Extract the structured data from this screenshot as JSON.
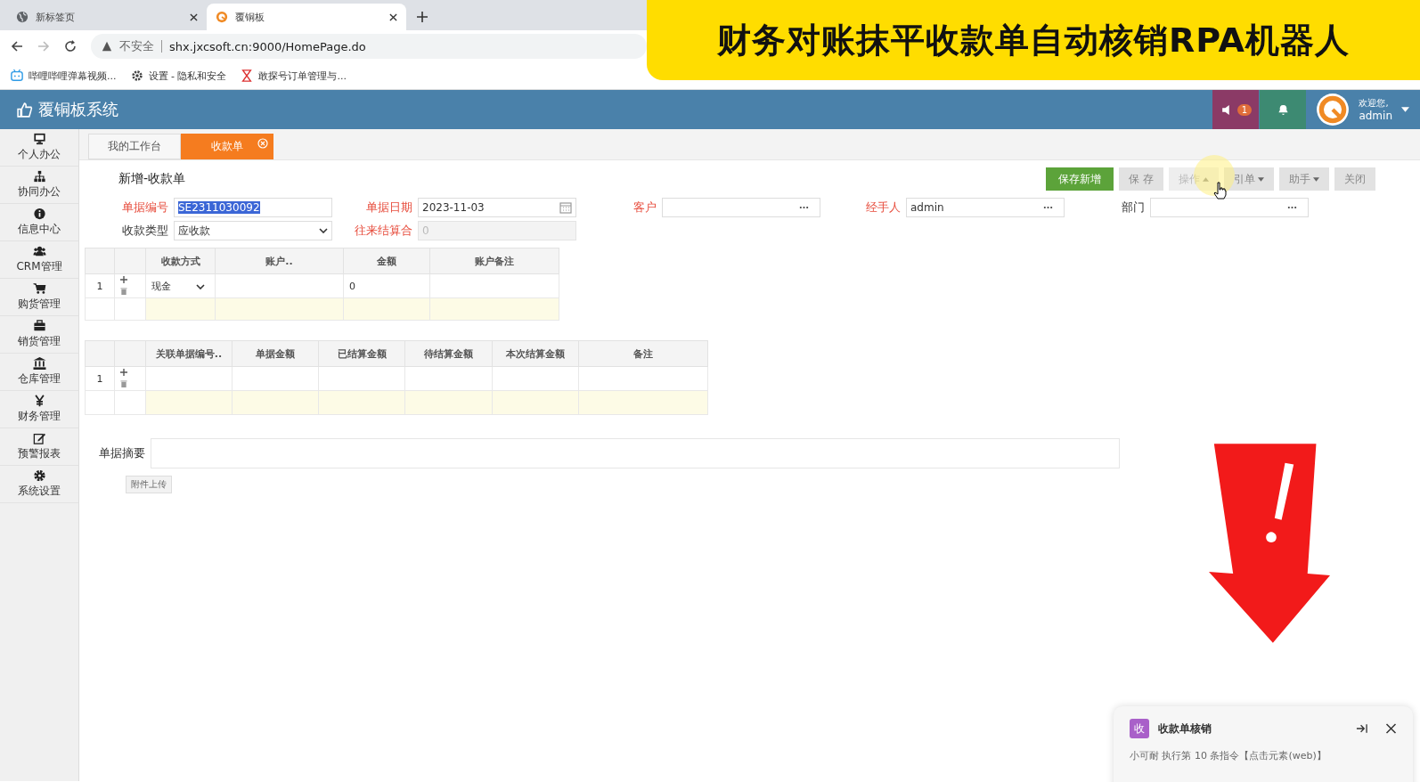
{
  "browser": {
    "tabs": [
      {
        "title": "新标签页",
        "selected": false
      },
      {
        "title": "覆铜板",
        "selected": true
      }
    ],
    "address": {
      "security": "不安全",
      "url": "shx.jxcsoft.cn:9000/HomePage.do"
    },
    "bookmarks": [
      "哔哩哔哩弹幕视频...",
      "设置 - 隐私和安全",
      "敢探号订单管理与..."
    ]
  },
  "app": {
    "title": "覆铜板系统",
    "badge": "1",
    "greeting": "欢迎您,",
    "user": "admin"
  },
  "sidebar": {
    "items": [
      {
        "label": "个人办公"
      },
      {
        "label": "协同办公"
      },
      {
        "label": "信息中心"
      },
      {
        "label": "CRM管理"
      },
      {
        "label": "购货管理"
      },
      {
        "label": "销货管理"
      },
      {
        "label": "仓库管理"
      },
      {
        "label": "财务管理"
      },
      {
        "label": "预警报表"
      },
      {
        "label": "系统设置"
      }
    ]
  },
  "page_tabs": [
    {
      "label": "我的工作台",
      "selected": false
    },
    {
      "label": "收款单",
      "selected": true,
      "closable": true
    }
  ],
  "form": {
    "title": "新增-收款单",
    "toolbar": [
      {
        "label": "保存新增",
        "kind": "primary",
        "dropdown": false
      },
      {
        "label": "保 存",
        "kind": "default",
        "dropdown": false
      },
      {
        "label": "操作",
        "kind": "hovered",
        "dropdown": true
      },
      {
        "label": "引单",
        "kind": "default",
        "dropdown": true
      },
      {
        "label": "助手",
        "kind": "default",
        "dropdown": true
      },
      {
        "label": "关闭",
        "kind": "default",
        "dropdown": false
      }
    ],
    "fields": [
      {
        "label": "单据编号",
        "required": true,
        "kind": "text",
        "value": "SE2311030092",
        "highlighted": true,
        "disabled": false
      },
      {
        "label": "单据日期",
        "required": true,
        "kind": "date",
        "value": "2023-11-03",
        "disabled": false
      },
      {
        "label": "客户",
        "required": true,
        "kind": "lookup",
        "disabled": false
      },
      {
        "label": "经手人",
        "required": true,
        "kind": "lookup",
        "value": "admin",
        "disabled": false
      },
      {
        "label": "部门",
        "required": false,
        "kind": "lookup",
        "disabled": false
      },
      {
        "label": "收款类型",
        "required": false,
        "kind": "select",
        "value": "应收款",
        "disabled": false
      },
      {
        "label": "往来结算合",
        "required": true,
        "kind": "text",
        "value": "0",
        "disabled": true
      }
    ],
    "payment_table": {
      "columns": [
        "收款方式",
        "账户..",
        "金额",
        "账户备注"
      ],
      "rows": [
        {
          "index": "1",
          "method": "现金",
          "amount": "0"
        }
      ]
    },
    "settlement_table": {
      "columns": [
        "关联单据编号..",
        "单据金额",
        "已结算金额",
        "待结算金额",
        "本次结算金额",
        "备注"
      ],
      "rows": [
        {
          "index": "1"
        }
      ]
    },
    "summary_label": "单据摘要",
    "upload_button": "附件上传"
  },
  "overlay_title": "财务对账抹平收款单自动核销RPA机器人",
  "notification": {
    "badge": "收",
    "title": "收款单核销",
    "message": "小可耐 执行第 10 条指令【点击元素(web)】"
  }
}
